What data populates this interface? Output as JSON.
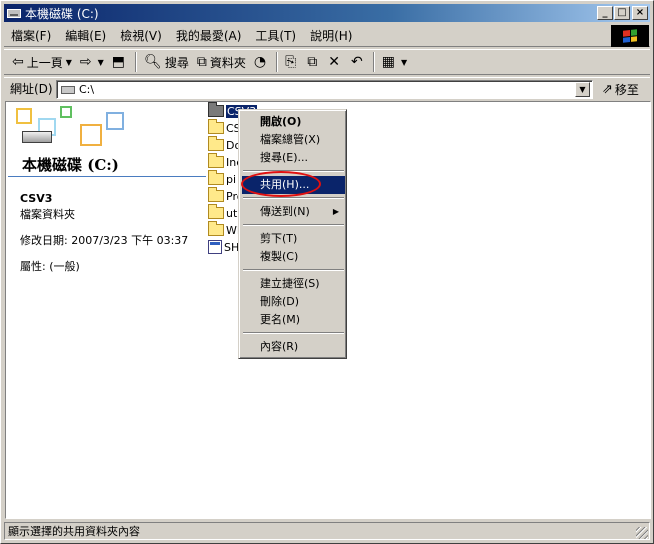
{
  "window": {
    "title": "本機磁碟 (C:)"
  },
  "titlebar_buttons": {
    "minimize": "_",
    "maximize": "□",
    "close": "×"
  },
  "menubar": [
    "檔案(F)",
    "編輯(E)",
    "檢視(V)",
    "我的最愛(A)",
    "工具(T)",
    "說明(H)"
  ],
  "toolbar": {
    "back": "上一頁",
    "search": "搜尋",
    "folders": "資料夾"
  },
  "address": {
    "label": "網址(D)",
    "value": "C:\\",
    "go": "移至"
  },
  "leftpane": {
    "drive_title": "本機磁碟 (C:)",
    "selected_name": "CSV3",
    "selected_type": "檔案資料夾",
    "modified": "修改日期: 2007/3/23 下午 03:37",
    "attributes": "屬性: (一般)"
  },
  "files": [
    {
      "name": "CSV3",
      "type": "folder",
      "selected": true
    },
    {
      "name": "CS",
      "type": "folder"
    },
    {
      "name": "Do",
      "type": "folder"
    },
    {
      "name": "Ine",
      "type": "folder"
    },
    {
      "name": "pi",
      "type": "folder"
    },
    {
      "name": "Pro",
      "type": "folder"
    },
    {
      "name": "util",
      "type": "folder"
    },
    {
      "name": "WI",
      "type": "folder"
    },
    {
      "name": "SH",
      "type": "file"
    }
  ],
  "context_menu": {
    "open": "開啟(O)",
    "explore": "檔案總管(X)",
    "search": "搜尋(E)...",
    "sharing": "共用(H)...",
    "send_to": "傳送到(N)",
    "cut": "剪下(T)",
    "copy": "複製(C)",
    "create_shortcut": "建立捷徑(S)",
    "delete": "刪除(D)",
    "rename": "更名(M)",
    "properties": "內容(R)",
    "highlighted": "sharing"
  },
  "status": {
    "text": "顯示選擇的共用資料夾內容"
  },
  "colors": {
    "title_active": "#0a246a",
    "highlight": "#0a246a",
    "annotation": "#e01010",
    "face": "#d4d0c8"
  }
}
